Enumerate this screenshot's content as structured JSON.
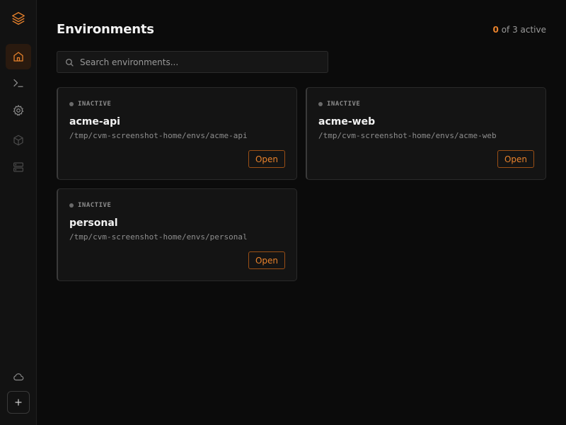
{
  "header": {
    "title": "Environments",
    "active_count": "0",
    "active_suffix": "of 3 active"
  },
  "search": {
    "placeholder": "Search environments...",
    "value": ""
  },
  "sidebar": {
    "items": [
      {
        "name": "home",
        "icon": "home-icon",
        "active": true
      },
      {
        "name": "terminal",
        "icon": "terminal-icon",
        "active": false
      },
      {
        "name": "settings",
        "icon": "gear-icon",
        "active": false
      },
      {
        "name": "packages",
        "icon": "cube-icon",
        "active": false
      },
      {
        "name": "servers",
        "icon": "server-icon",
        "active": false
      },
      {
        "name": "cloud",
        "icon": "cloud-icon",
        "active": false
      }
    ],
    "add_icon": "plus-icon"
  },
  "environments": [
    {
      "status": "INACTIVE",
      "name": "acme-api",
      "path": "/tmp/cvm-screenshot-home/envs/acme-api",
      "action": "Open"
    },
    {
      "status": "INACTIVE",
      "name": "acme-web",
      "path": "/tmp/cvm-screenshot-home/envs/acme-web",
      "action": "Open"
    },
    {
      "status": "INACTIVE",
      "name": "personal",
      "path": "/tmp/cvm-screenshot-home/envs/personal",
      "action": "Open"
    }
  ],
  "colors": {
    "accent": "#e8822c",
    "background": "#0b0b0b",
    "card": "#141414",
    "inactive_dot": "#6a6a6a"
  }
}
